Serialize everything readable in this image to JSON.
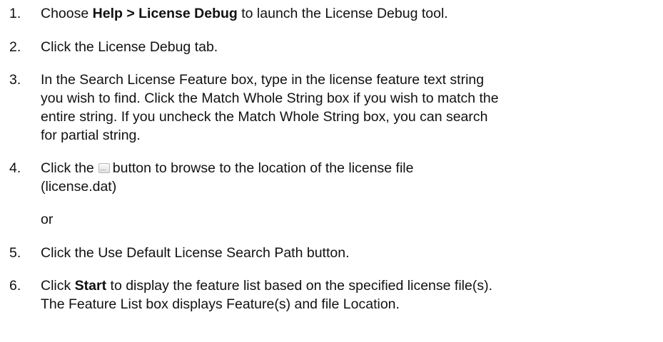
{
  "steps": [
    {
      "number": "1.",
      "pre": "Choose ",
      "bold": "Help > License Debug",
      "post": " to launch the License Debug tool."
    },
    {
      "number": "2.",
      "text": "Click the License Debug tab."
    },
    {
      "number": "3.",
      "lines": [
        "In the Search License Feature box, type in the license feature text string",
        "you wish to find. Click the Match Whole String box if you wish to match the",
        "entire string. If you uncheck the Match Whole String box, you can search",
        "for partial string."
      ]
    },
    {
      "number": "4.",
      "pre": "Click the",
      "icon": "browse-ellipsis-icon",
      "icon_glyph": "...",
      "post": "button to browse to the location of the license file",
      "line2": "(license.dat)"
    },
    {
      "or_text": "or"
    },
    {
      "number": "5.",
      "text": "Click the Use Default License Search Path button."
    },
    {
      "number": "6.",
      "pre": "Click ",
      "bold": "Start",
      "post": " to display the feature list based on the specified license file(s).",
      "line2": "The Feature List box displays Feature(s) and file Location."
    }
  ]
}
